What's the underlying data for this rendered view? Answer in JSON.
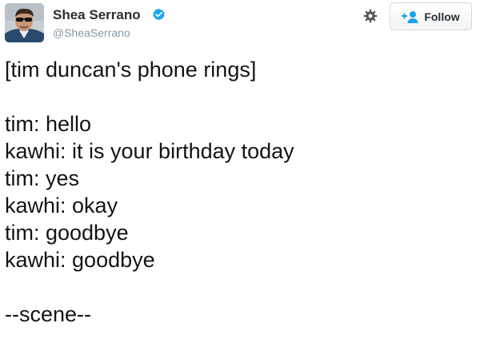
{
  "user": {
    "display_name": "Shea Serrano",
    "handle": "@SheaSerrano",
    "verified": true,
    "avatar": "profile-photo"
  },
  "actions": {
    "settings_icon": "gear-icon",
    "follow_label": "Follow",
    "follow_icon": "add-user-icon"
  },
  "colors": {
    "verified_badge": "#1da1f2",
    "follow_icon": "#1da1f2",
    "handle_text": "#8899a6"
  },
  "tweet": {
    "lines": [
      "[tim duncan's phone rings]",
      "",
      "tim: hello",
      "kawhi: it is your birthday today",
      "tim: yes",
      "kawhi: okay",
      "tim: goodbye",
      "kawhi: goodbye",
      "",
      "--scene--"
    ]
  }
}
